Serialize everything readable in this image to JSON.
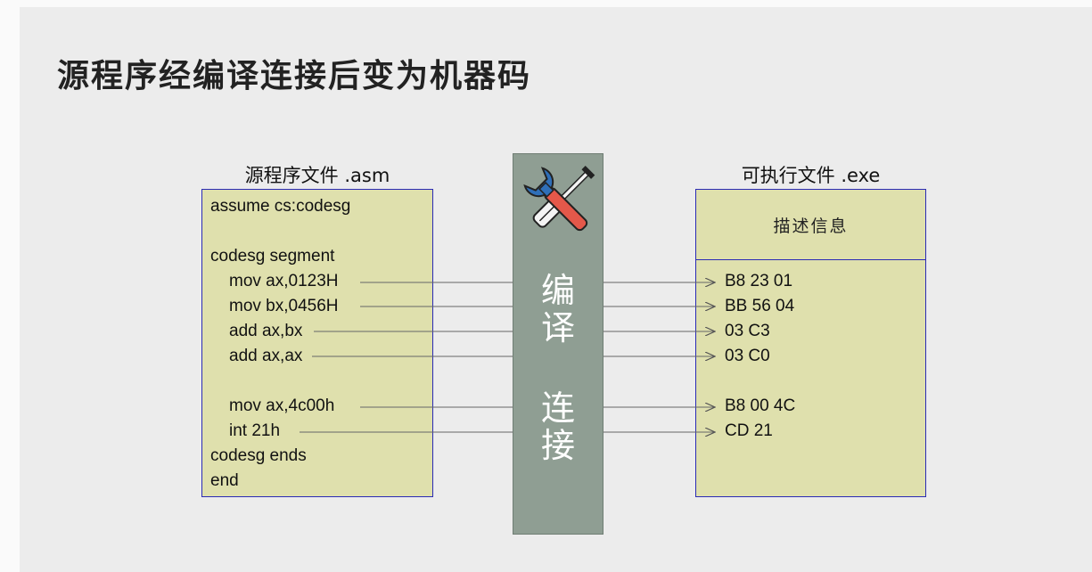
{
  "title": "源程序经编译连接后变为机器码",
  "source": {
    "label": "源程序文件 .asm",
    "lines": [
      "assume cs:codesg",
      "codesg segment",
      "mov ax,0123H",
      "mov bx,0456H",
      "add ax,bx",
      "add ax,ax",
      "mov ax,4c00h",
      "int 21h",
      "codesg ends",
      "end"
    ]
  },
  "tool": {
    "icon": "wrench-screwdriver-icon",
    "compile_chars": [
      "编",
      "译"
    ],
    "link_chars": [
      "连",
      "接"
    ]
  },
  "executable": {
    "label": "可执行文件 .exe",
    "header": "描述信息",
    "codes": [
      "B8 23 01",
      "BB 56 04",
      "03 C3",
      "03 C0",
      "B8 00 4C",
      "CD 21"
    ]
  },
  "colors": {
    "box_fill": "#dfe0ad",
    "box_border": "#2b2bb5",
    "bar_fill": "#8f9e93",
    "arrow": "#555555"
  }
}
